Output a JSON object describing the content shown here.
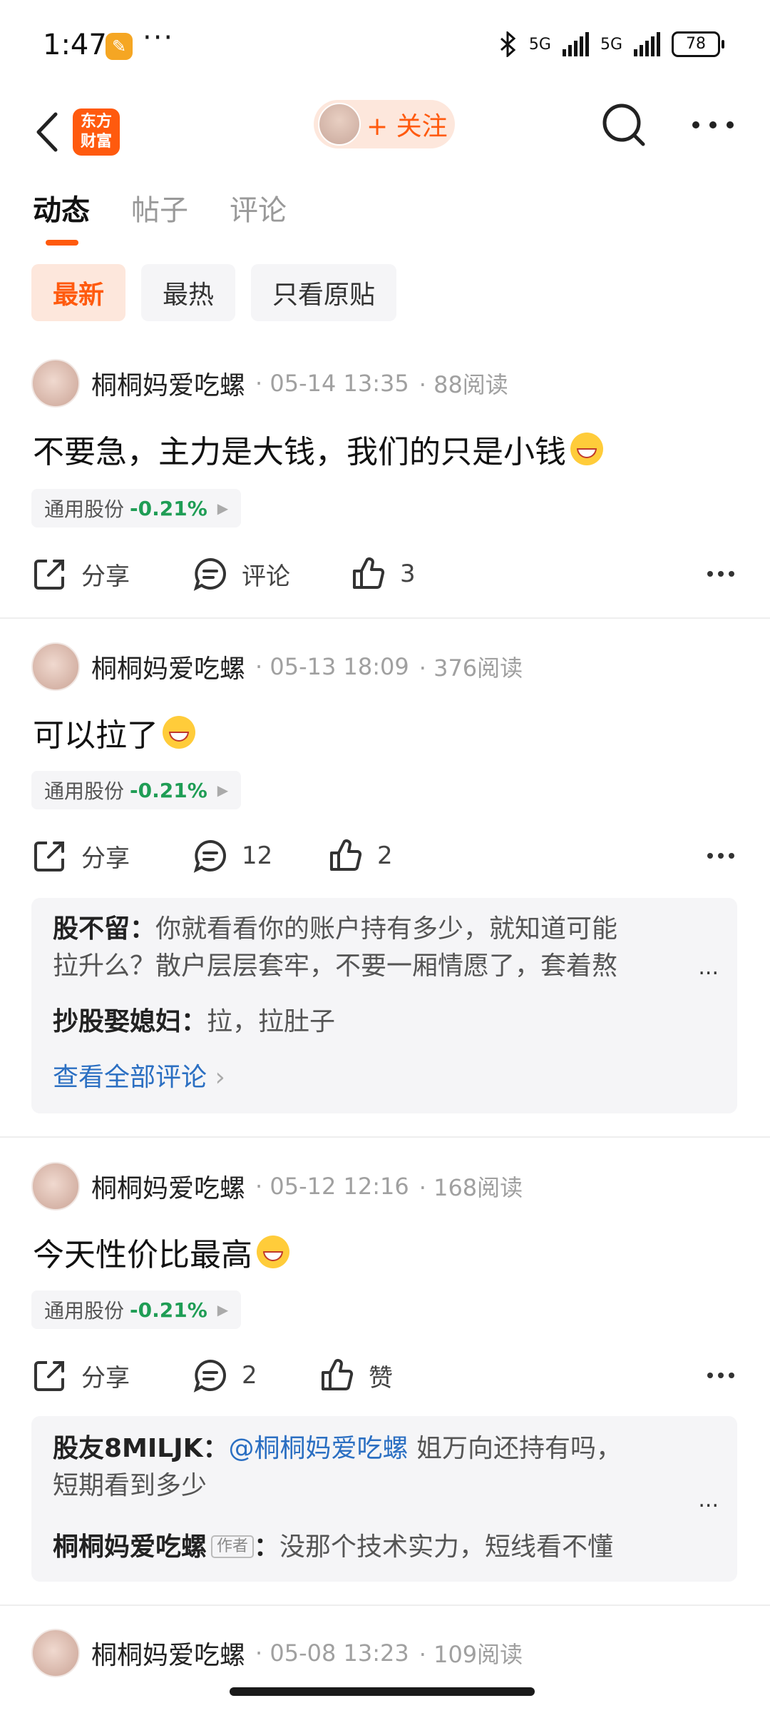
{
  "status_bar": {
    "time": "1:47",
    "network_1": "5G",
    "network_2": "5G",
    "battery": "78"
  },
  "header": {
    "logo_line1": "东方",
    "logo_line2": "财富",
    "follow_label": "+ 关注"
  },
  "tabs": [
    {
      "label": "动态"
    },
    {
      "label": "帖子"
    },
    {
      "label": "评论"
    }
  ],
  "filters": [
    {
      "label": "最新"
    },
    {
      "label": "最热"
    },
    {
      "label": "只看原贴"
    }
  ],
  "posts": [
    {
      "author": "桐桐妈爱吃螺",
      "date": "· 05-14 13:35",
      "reads": "· 88阅读",
      "text": "不要急，主力是大钱，我们的只是小钱",
      "stock_name": "通用股份",
      "stock_change": "-0.21%",
      "share_label": "分享",
      "comment_label": "评论",
      "like_label": "3"
    },
    {
      "author": "桐桐妈爱吃螺",
      "date": "· 05-13 18:09",
      "reads": "· 376阅读",
      "text": "可以拉了",
      "stock_name": "通用股份",
      "stock_change": "-0.21%",
      "share_label": "分享",
      "comment_label": "12",
      "like_label": "2",
      "comments": [
        {
          "user": "股不留：",
          "text_line1": "你就看看你的账户持有多少，就知道可能",
          "text_line2": "拉升么？散户层层套牢，不要一厢情愿了，套着熬"
        },
        {
          "user": "抄股娶媳妇：",
          "text": "拉，拉肚子"
        }
      ],
      "view_all": "查看全部评论",
      "more_dots": "..."
    },
    {
      "author": "桐桐妈爱吃螺",
      "date": "· 05-12 12:16",
      "reads": "· 168阅读",
      "text": "今天性价比最高",
      "stock_name": "通用股份",
      "stock_change": "-0.21%",
      "share_label": "分享",
      "comment_label": "2",
      "like_label": "赞",
      "comments": [
        {
          "user": "股友8MILJK：",
          "mention": "@桐桐妈爱吃螺",
          "text_line1": " 姐万向还持有吗，",
          "text_line2": "短期看到多少"
        },
        {
          "user": "桐桐妈爱吃螺",
          "badge": "作者",
          "colon": "：",
          "text": "没那个技术实力，短线看不懂"
        }
      ],
      "more_dots": "..."
    },
    {
      "author": "桐桐妈爱吃螺",
      "date": "· 05-08 13:23",
      "reads": "· 109阅读"
    }
  ],
  "colors": {
    "accent": "#ff5a0e",
    "stock_down": "#1f9d55",
    "link": "#2b6fc2"
  }
}
